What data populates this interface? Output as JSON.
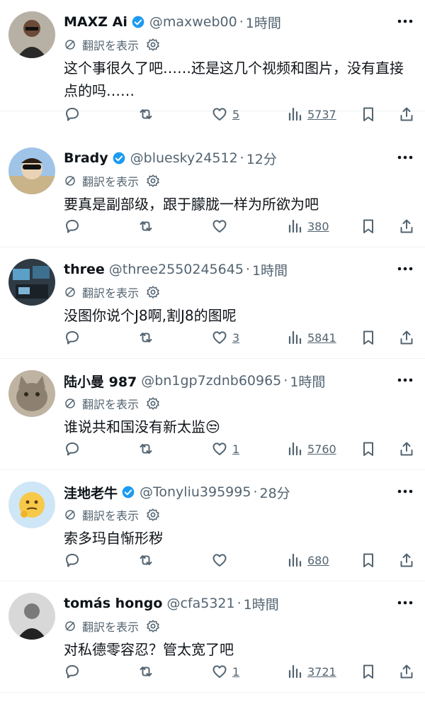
{
  "ui": {
    "translate_label": "翻訳を表示"
  },
  "tweets": [
    {
      "name": "MAXZ Ai",
      "verified": true,
      "handle": "@maxweb00",
      "time": "1時間",
      "text": "这个事很久了吧……还是这几个视频和图片，没有直接点的吗……",
      "replies": "",
      "retweets": "",
      "likes": "5",
      "views": "5737"
    },
    {
      "name": "Brady",
      "verified": true,
      "handle": "@bluesky24512",
      "time": "12分",
      "text": "要真是副部级，跟于朦胧一样为所欲为吧",
      "replies": "",
      "retweets": "",
      "likes": "",
      "views": "380"
    },
    {
      "name": "three",
      "verified": false,
      "handle": "@three2550245645",
      "time": "1時間",
      "text": "没图你说个J8啊,割J8的图呢",
      "replies": "",
      "retweets": "",
      "likes": "3",
      "views": "5841"
    },
    {
      "name": "陆小曼 987",
      "verified": false,
      "handle": "@bn1gp7zdnb60965",
      "time": "1時間",
      "text": "谁说共和国没有新太监😒",
      "replies": "",
      "retweets": "",
      "likes": "1",
      "views": "5760"
    },
    {
      "name": "洼地老牛",
      "verified": true,
      "handle": "@Tonyliu395995",
      "time": "28分",
      "text": "索多玛自惭形秽",
      "replies": "",
      "retweets": "",
      "likes": "",
      "views": "680"
    },
    {
      "name": "tomás hongo",
      "verified": false,
      "handle": "@cfa5321",
      "time": "1時間",
      "text": "对私德零容忍？管太宽了吧",
      "replies": "",
      "retweets": "",
      "likes": "1",
      "views": "3721"
    }
  ],
  "colors": {
    "text": "#0f1419",
    "secondary": "#536471",
    "verified": "#1d9bf0",
    "divider": "#eff3f4"
  }
}
